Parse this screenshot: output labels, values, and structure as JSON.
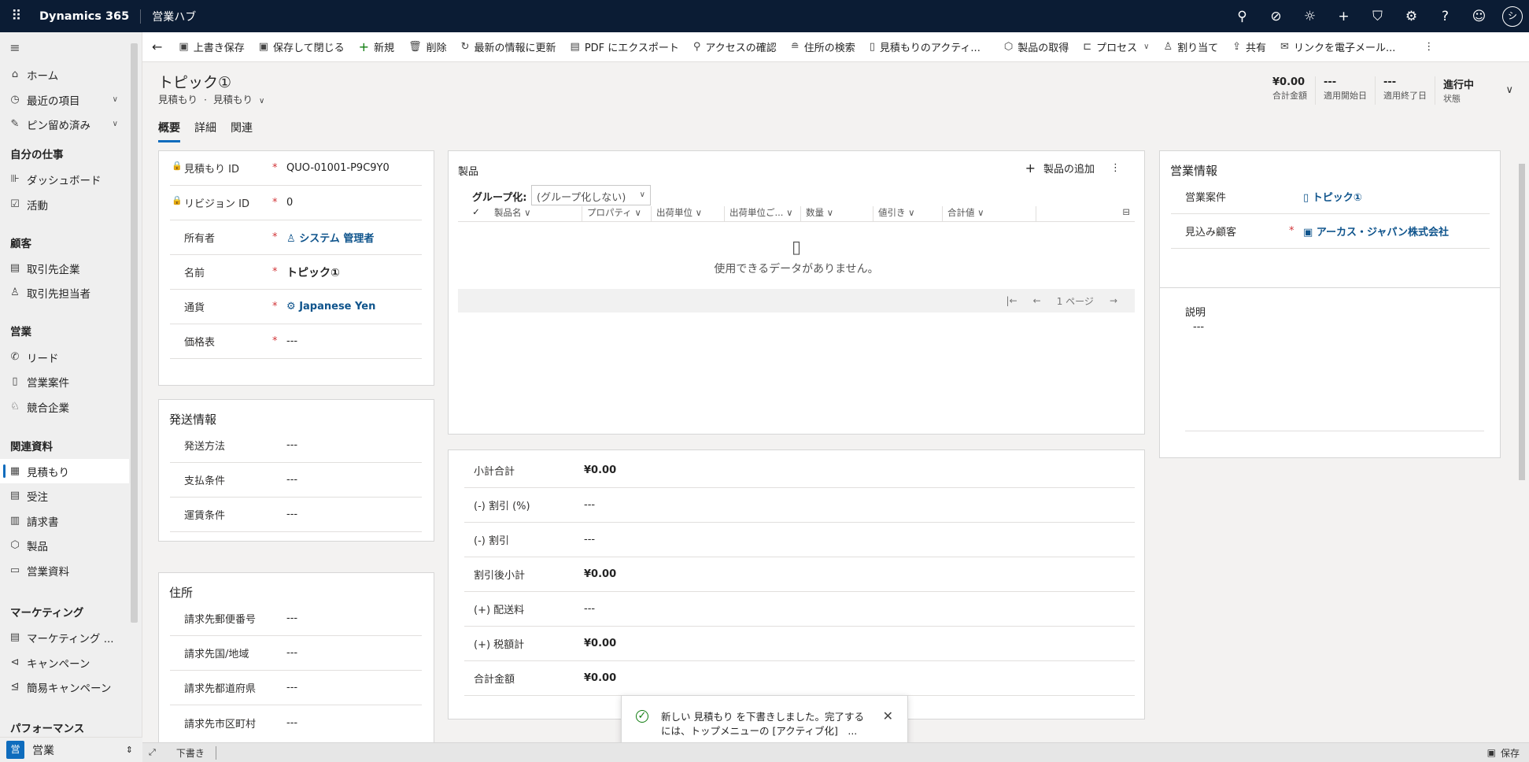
{
  "topbar": {
    "brand": "Dynamics 365",
    "app": "営業ハブ",
    "icons": [
      "search-icon",
      "task-icon",
      "lightbulb-icon",
      "plus-icon",
      "filter-icon",
      "gear-icon",
      "help-icon",
      "feedback-icon"
    ],
    "avatar": "シ"
  },
  "sidebar": {
    "items": [
      {
        "label": "ホーム",
        "icon": "home-icon"
      },
      {
        "label": "最近の項目",
        "icon": "clock-icon"
      },
      {
        "label": "ピン留め済み",
        "icon": "pin-icon"
      }
    ],
    "groups": {
      "my_work": "自分の仕事",
      "customers": "顧客",
      "sales": "営業",
      "collateral": "関連資料",
      "marketing": "マーケティング",
      "performance": "パフォーマンス"
    },
    "my_work_items": [
      "ダッシュボード",
      "活動"
    ],
    "customer_items": [
      "取引先企業",
      "取引先担当者"
    ],
    "sales_items": [
      "リード",
      "営業案件",
      "競合企業"
    ],
    "collateral_items": [
      "見積もり",
      "受注",
      "請求書",
      "製品",
      "営業資料"
    ],
    "marketing_items": [
      "マーケティング ...",
      "キャンペーン",
      "簡易キャンペーン"
    ],
    "area_badge": "営",
    "area_label": "営業"
  },
  "commandbar": {
    "save": "上書き保存",
    "save_close": "保存して閉じる",
    "new": "新規",
    "delete": "削除",
    "refresh": "最新の情報に更新",
    "export_pdf": "PDF にエクスポート",
    "check_access": "アクセスの確認",
    "lookup_address": "住所の検索",
    "activate_quote": "見積もりのアクティ...",
    "get_products": "製品の取得",
    "process": "プロセス",
    "assign": "割り当て",
    "share": "共有",
    "email_link": "リンクを電子メール..."
  },
  "header": {
    "title": "トピック①",
    "entity": "見積もり",
    "form": "見積もり",
    "separator": "·",
    "fields": [
      {
        "value": "¥0.00",
        "label": "合計金額"
      },
      {
        "value": "---",
        "label": "適用開始日"
      },
      {
        "value": "---",
        "label": "適用終了日"
      },
      {
        "value": "進行中",
        "label": "状態"
      }
    ]
  },
  "tabs": [
    "概要",
    "詳細",
    "関連"
  ],
  "general": {
    "fields": [
      {
        "label": "見積もり ID",
        "value": "QUO-01001-P9C9Y0",
        "req": "*"
      },
      {
        "label": "リビジョン ID",
        "value": "0",
        "req": "*"
      },
      {
        "label": "所有者",
        "value": "システム 管理者",
        "req": "*"
      },
      {
        "label": "名前",
        "value": "トピック①",
        "req": "*"
      },
      {
        "label": "通貨",
        "value": "Japanese Yen",
        "req": "*"
      },
      {
        "label": "価格表",
        "value": "---",
        "req": "*"
      }
    ]
  },
  "shipping": {
    "title": "発送情報",
    "fields": [
      {
        "label": "発送方法",
        "value": "---"
      },
      {
        "label": "支払条件",
        "value": "---"
      },
      {
        "label": "運賃条件",
        "value": "---"
      }
    ]
  },
  "address": {
    "title": "住所",
    "fields": [
      {
        "label": "請求先郵便番号",
        "value": "---"
      },
      {
        "label": "請求先国/地域",
        "value": "---"
      },
      {
        "label": "請求先都道府県",
        "value": "---"
      },
      {
        "label": "請求先市区町村",
        "value": "---"
      }
    ]
  },
  "products": {
    "title": "製品",
    "add_label": "製品の追加",
    "groupby_label": "グループ化:",
    "groupby_value": "(グループ化しない)",
    "columns": [
      "製品名",
      "プロパティ",
      "出荷単位",
      "出荷単位ご...",
      "数量",
      "値引き",
      "合計値"
    ],
    "empty": "使用できるデータがありません。",
    "page": "1 ページ"
  },
  "summary": {
    "rows": [
      {
        "label": "小計合計",
        "value": "¥0.00"
      },
      {
        "label": "(-) 割引 (%)",
        "value": "---"
      },
      {
        "label": "(-) 割引",
        "value": "---"
      },
      {
        "label": "割引後小計",
        "value": "¥0.00"
      },
      {
        "label": "(+) 配送料",
        "value": "---"
      },
      {
        "label": "(+) 税額計",
        "value": "¥0.00"
      },
      {
        "label": "合計金額",
        "value": "¥0.00"
      }
    ]
  },
  "sales_info": {
    "title": "営業情報",
    "opportunity_label": "営業案件",
    "opportunity_value": "トピック①",
    "prospect_label": "見込み顧客",
    "prospect_req": "*",
    "prospect_value": "アーカス・ジャパン株式会社"
  },
  "description": {
    "label": "説明",
    "value": "---"
  },
  "toast": {
    "message": "新しい 見積もり を下書きしました。完了するには、トップメニューの [アクティブ化]　..."
  },
  "statusbar": {
    "status": "下書き",
    "save": "保存"
  }
}
